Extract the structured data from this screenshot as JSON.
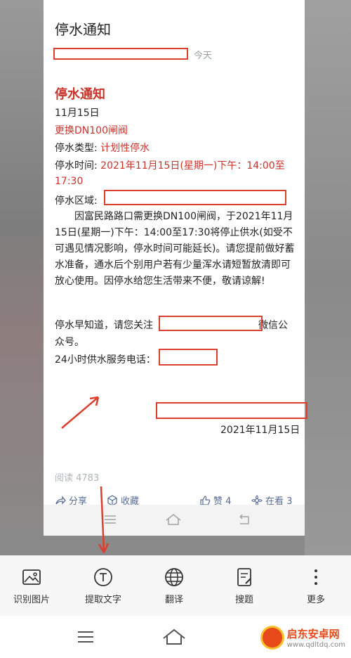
{
  "article": {
    "title": "停水通知",
    "meta_time": "今天",
    "notice_title": "停水通知",
    "date_line": "11月15日",
    "subtitle": "更换DN100闸阀",
    "type_label": "停水类型: ",
    "type_value": "计划性停水",
    "time_label": "停水时间: ",
    "time_value_1": "2021年11月15日(星期一)下午：14:00至",
    "time_value_2": "17:30",
    "area_label": "停水区域: ",
    "paragraph": "因富民路路口需更换DN100闸阀，于2021年11月15日(星期一)下午：14:00至17:30将停止供水(如受不可遇见情况影响，停水时间可能延长)。请您提前做好蓄水准备，通水后个别用户若有少量浑水请短暂放清即可放心使用。因停水给您生活带来不便，敬请谅解!",
    "follow_line_1_prefix": "停水早知道，请您关注",
    "follow_line_1_suffix": "微信公",
    "follow_line_2": "众号。",
    "hotline": "24小时供水服务电话：",
    "sign_date": "2021年11月15日",
    "reads": "阅读 4783"
  },
  "actions": {
    "share": "分享",
    "favorite": "收藏",
    "like": "赞 4",
    "watching": "在看 3"
  },
  "toolbar": [
    {
      "label": "识别图片",
      "icon": "image-icon"
    },
    {
      "label": "提取文字",
      "icon": "text-extract-icon"
    },
    {
      "label": "翻译",
      "icon": "globe-icon"
    },
    {
      "label": "搜题",
      "icon": "search-question-icon"
    },
    {
      "label": "更多",
      "icon": "more-vertical-icon"
    }
  ],
  "watermark": {
    "title": "启东安卓网",
    "url": "www.qdltdq.com"
  },
  "colors": {
    "accent_red": "#c8332b",
    "link_blue": "#576b95",
    "annotation_red": "#d9412e"
  }
}
